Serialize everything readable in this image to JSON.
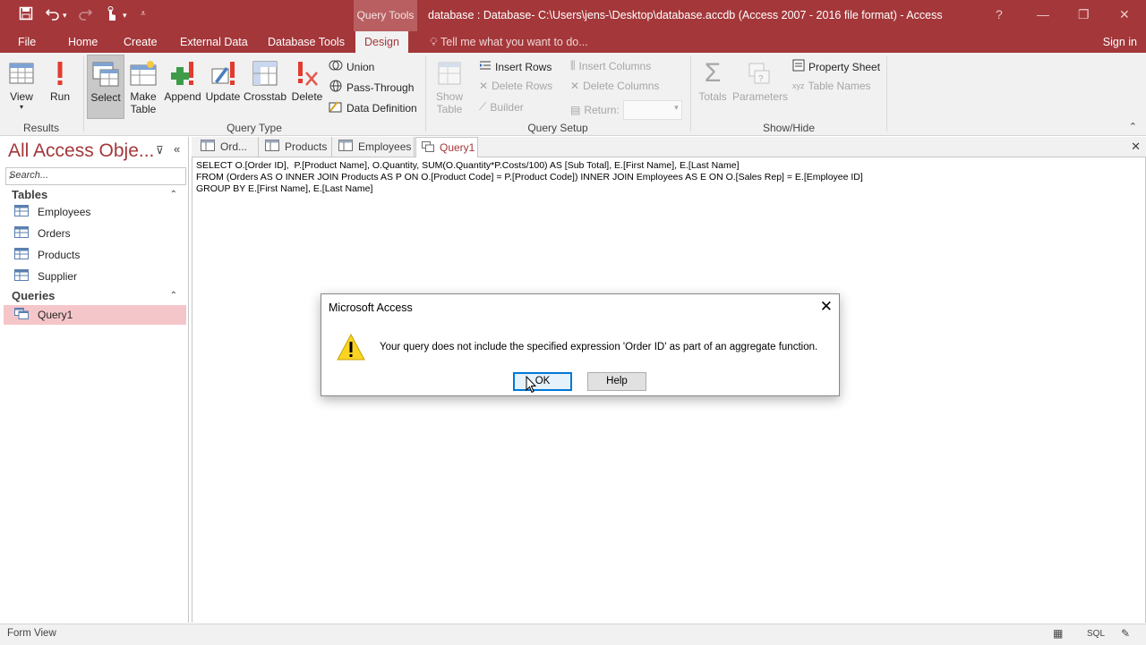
{
  "title_bar": {
    "context_tab": "Query Tools",
    "window_title": "database : Database- C:\\Users\\jens-\\Desktop\\database.accdb (Access 2007 - 2016 file format) - Access"
  },
  "ribbon_tabs": {
    "file": "File",
    "home": "Home",
    "create": "Create",
    "external": "External Data",
    "dbtools": "Database Tools",
    "design": "Design",
    "tell_me": "Tell me what you want to do...",
    "sign_in": "Sign in"
  },
  "ribbon": {
    "results": {
      "label": "Results",
      "view": "View",
      "run": "Run"
    },
    "query_type": {
      "label": "Query Type",
      "select": "Select",
      "make_table_1": "Make",
      "make_table_2": "Table",
      "append": "Append",
      "update": "Update",
      "crosstab": "Crosstab",
      "delete": "Delete",
      "union": "Union",
      "pass_through": "Pass-Through",
      "data_definition": "Data Definition"
    },
    "query_setup": {
      "label": "Query Setup",
      "show_table_1": "Show",
      "show_table_2": "Table",
      "insert_rows": "Insert Rows",
      "delete_rows": "Delete Rows",
      "builder": "Builder",
      "insert_columns": "Insert Columns",
      "delete_columns": "Delete Columns",
      "return": "Return:"
    },
    "show_hide": {
      "label": "Show/Hide",
      "totals": "Totals",
      "parameters": "Parameters",
      "property_sheet": "Property Sheet",
      "table_names": "Table Names"
    }
  },
  "nav_pane": {
    "title": "All Access Obje...",
    "search_placeholder": "Search...",
    "tables_header": "Tables",
    "tables": [
      "Employees",
      "Orders",
      "Products",
      "Supplier"
    ],
    "queries_header": "Queries",
    "queries": [
      "Query1"
    ]
  },
  "doc_tabs": [
    "Ord...",
    "Products",
    "Employees",
    "Query1"
  ],
  "sql": {
    "line1": "SELECT O.[Order ID],  P.[Product Name], O.Quantity, SUM(O.Quantity*P.Costs/100) AS [Sub Total], E.[First Name], E.[Last Name]",
    "line2": "FROM (Orders AS O INNER JOIN Products AS P ON O.[Product Code] = P.[Product Code]) INNER JOIN Employees AS E ON O.[Sales Rep] = E.[Employee ID]",
    "line3": "GROUP BY E.[First Name], E.[Last Name]"
  },
  "dialog": {
    "title": "Microsoft Access",
    "message": "Your query does not include the specified expression 'Order ID' as part of an aggregate function.",
    "ok": "OK",
    "help": "Help"
  },
  "status_bar": {
    "text": "Form View",
    "sql_view": "SQL"
  },
  "colors": {
    "accent": "#a4373a",
    "selection": "#f5c6c9"
  }
}
